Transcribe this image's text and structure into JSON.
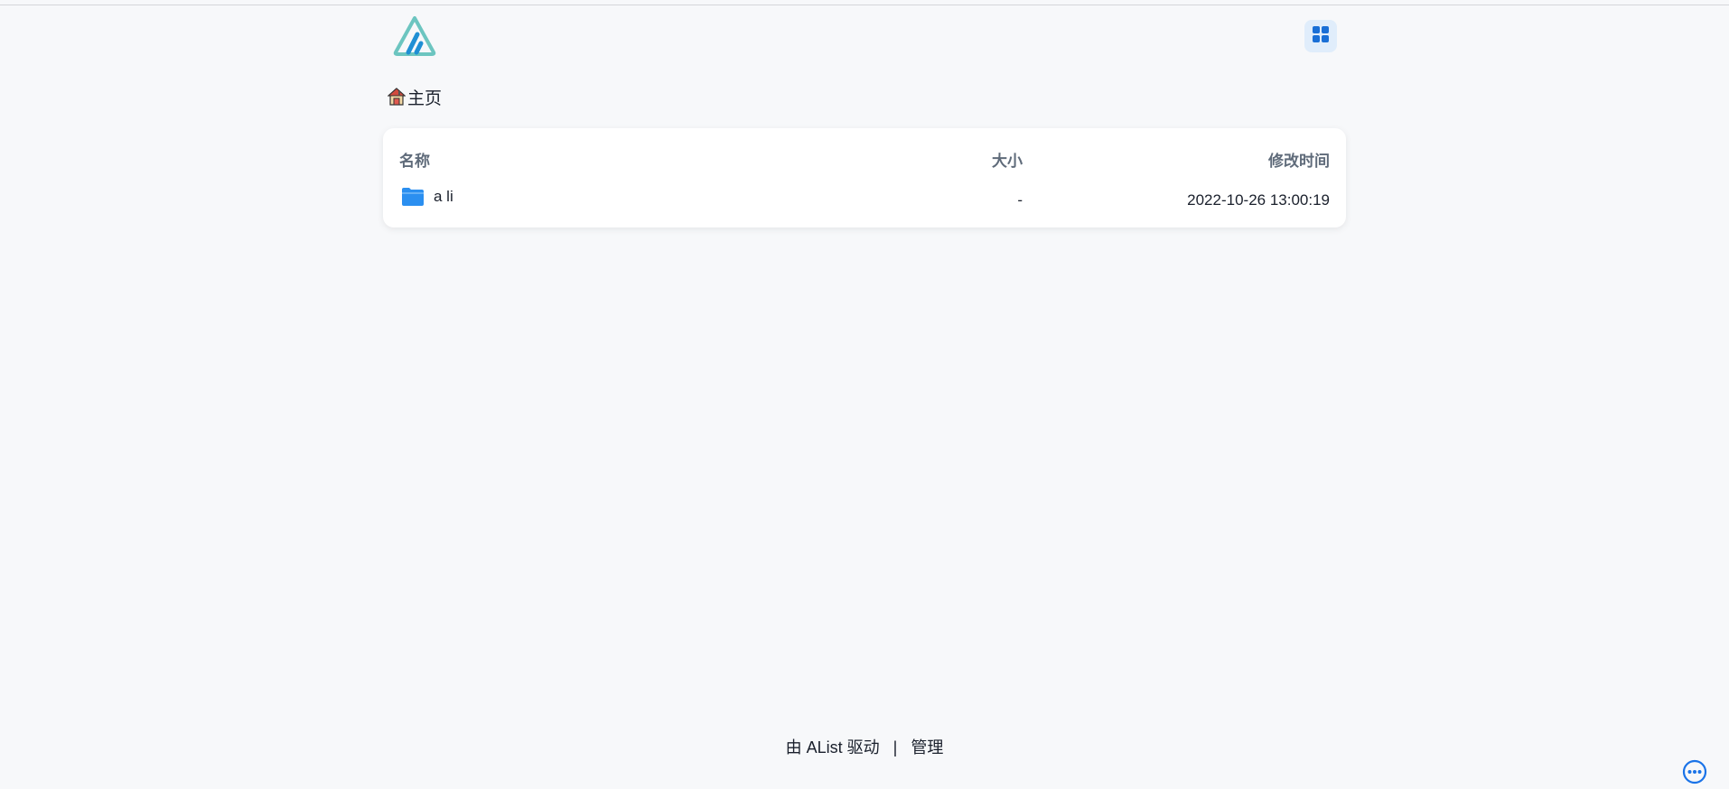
{
  "header": {
    "logo_icon": "alist-logo-icon",
    "layout_toggle_icon": "grid-view-icon"
  },
  "breadcrumb": {
    "home_icon": "home-icon",
    "home_label": "主页"
  },
  "file_list": {
    "columns": {
      "name": "名称",
      "size": "大小",
      "modified": "修改时间"
    },
    "rows": [
      {
        "icon": "folder-icon",
        "name": "a li",
        "size": "-",
        "modified": "2022-10-26 13:00:19"
      }
    ]
  },
  "footer": {
    "powered_by": "由 AList 驱动",
    "separator": "|",
    "manage_link": "管理"
  },
  "floating": {
    "more_icon": "more-icon"
  },
  "colors": {
    "background": "#f7f8fa",
    "accent": "#1a73e8",
    "folder": "#2b8ff0",
    "logo_teal": "#6cc5c0",
    "logo_blue": "#1f8fd4",
    "toggle_bg": "#e0edfb"
  }
}
